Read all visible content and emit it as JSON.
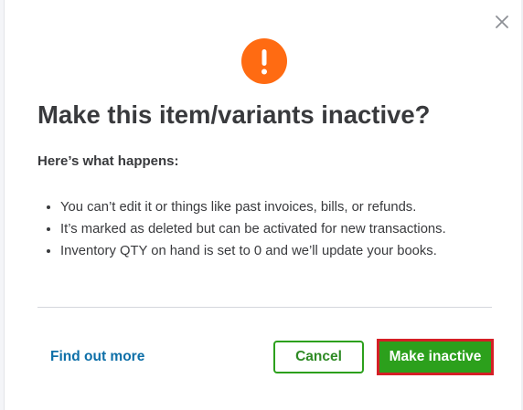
{
  "dialog": {
    "close_icon": "close-icon",
    "alert_icon": "exclamation-icon",
    "alert_color": "#ff6b12",
    "title": "Make this item/variants inactive?",
    "subtitle": "Here’s what happens:",
    "bullets": [
      "You can’t edit it or things like past invoices, bills, or refunds.",
      "It’s marked as deleted but can be activated for new transactions.",
      "Inventory QTY on hand is set to 0 and we’ll update your books."
    ],
    "find_out_more_label": "Find out more",
    "cancel_label": "Cancel",
    "make_inactive_label": "Make inactive",
    "primary_color": "#2ca01c",
    "link_color": "#0d6fa8",
    "highlight_color": "#d51f26"
  }
}
